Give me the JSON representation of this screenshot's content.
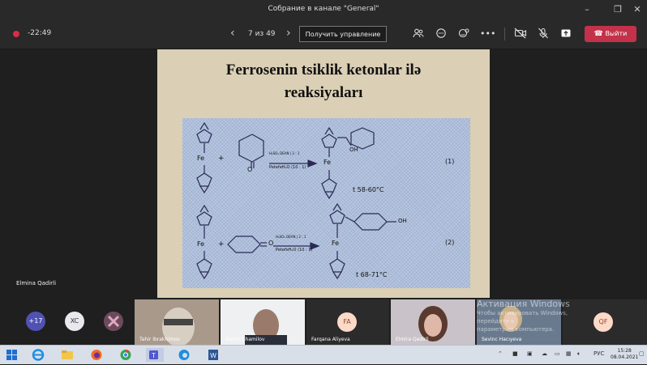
{
  "window": {
    "title": "Собрание в канале \"General\""
  },
  "toolbar": {
    "timer": "-22:49",
    "page_indicator": "7 из 49",
    "control_button": "Получить управление",
    "leave_button": "Выйти"
  },
  "slide": {
    "title_line1": "Ferrosenin tsiklik ketonlar ilə",
    "title_line2": "reaksiyaları",
    "reactions": [
      {
        "fe": "Fe",
        "plus": "+",
        "oxygen": "O",
        "cond1": "H₂SO₄ DEAN | 2 : 1",
        "cond2": "PetefeH₂O (10 : 1)",
        "product_fe": "Fe",
        "product_oh": "OH",
        "temp": "t  58-60°C",
        "number": "(1)"
      },
      {
        "fe": "Fe",
        "plus": "+",
        "oxygen": "O",
        "cond1": "H₂SO₄ DEAN | 2 : 1",
        "cond2": "PetefeH₂O (10 : 1)",
        "product_fe": "Fe",
        "product_oh": "OH",
        "temp": "t  68-71°C",
        "number": "(2)"
      }
    ]
  },
  "presenter": {
    "name": "Elmina Qadirli"
  },
  "participants": {
    "overflow": "+17",
    "avatars": [
      {
        "initials": "XC",
        "color": "#e8e8ee",
        "text_color": "#333333"
      },
      {
        "initials": "FA",
        "color": "#ffd9c8",
        "text_color": "#8a4a2c"
      },
      {
        "initials": "QF",
        "color": "#ffd9c8",
        "text_color": "#8a4a2c"
      }
    ],
    "tiles": [
      {
        "name": "Tahir Ibrakhimov"
      },
      {
        "name": "Nazim Shamilov"
      },
      {
        "name": "Farqana Aliyeva"
      },
      {
        "name": "Elmira Qadirli"
      },
      {
        "name": "Sevinc Hacıyeva"
      }
    ]
  },
  "watermark": {
    "line1": "Активация Windows",
    "line2": "Чтобы активировать Windows, перейдите к",
    "line3": "параметрам компьютера."
  },
  "taskbar": {
    "language": "РУС",
    "time": "15:28",
    "date": "08.04.2021"
  }
}
